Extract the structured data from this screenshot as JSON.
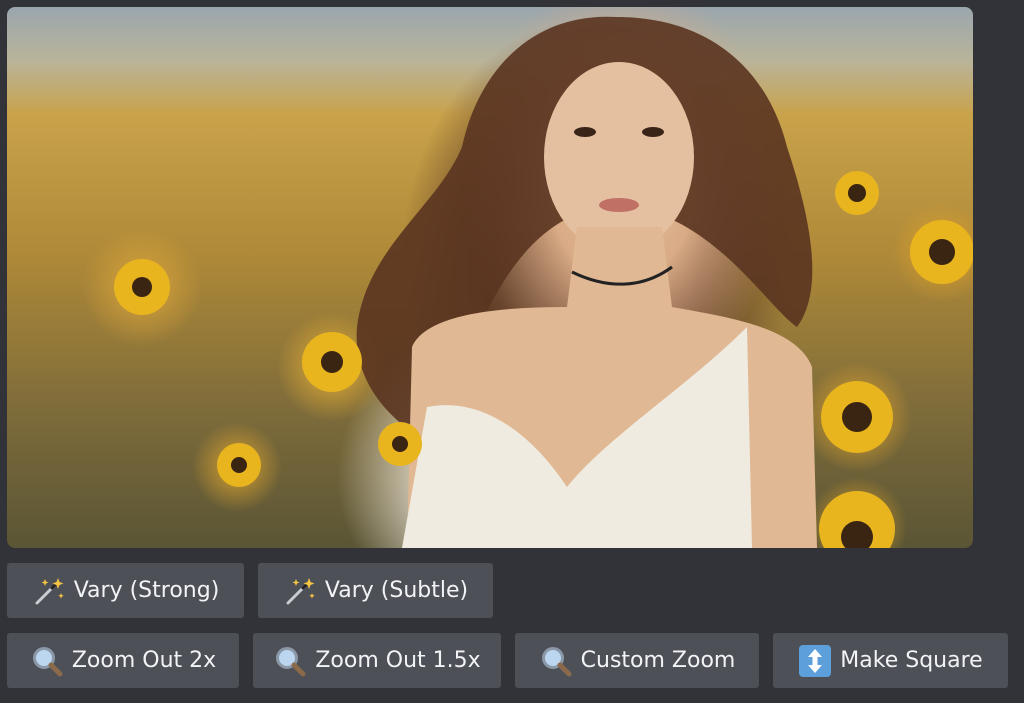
{
  "image": {
    "alt": "Woman with curly hair standing in a sunflower field"
  },
  "buttons_row1": [
    {
      "label": "Vary (Strong)",
      "icon": "magic-wand-icon"
    },
    {
      "label": "Vary (Subtle)",
      "icon": "magic-wand-icon"
    }
  ],
  "buttons_row2": [
    {
      "label": "Zoom Out 2x",
      "icon": "magnifier-icon"
    },
    {
      "label": "Zoom Out 1.5x",
      "icon": "magnifier-icon"
    },
    {
      "label": "Custom Zoom",
      "icon": "magnifier-icon"
    },
    {
      "label": "Make Square",
      "icon": "up-down-arrow-icon"
    }
  ],
  "colors": {
    "background": "#313338",
    "button": "#4e5058",
    "text": "#f2f3f5",
    "accent_blue": "#5c9fdb"
  }
}
